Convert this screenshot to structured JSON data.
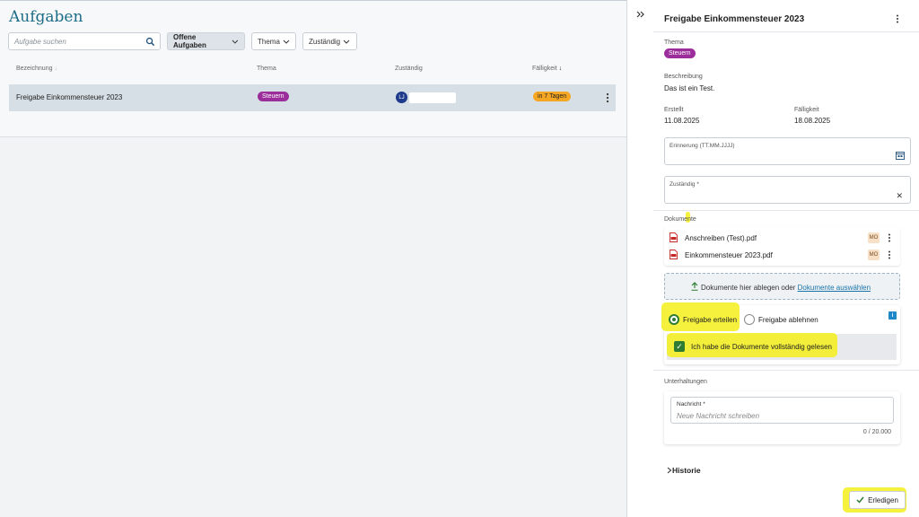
{
  "page": {
    "title": "Aufgaben"
  },
  "filters": {
    "search_placeholder": "Aufgabe suchen",
    "open_tasks": "Offene Aufgaben",
    "topic": "Thema",
    "responsible": "Zuständig"
  },
  "table": {
    "headers": {
      "name": "Bezeichnung",
      "topic": "Thema",
      "responsible": "Zuständig",
      "due": "Fälligkeit"
    },
    "rows": [
      {
        "name": "Freigabe Einkommensteuer 2023",
        "topic": "Steuern",
        "avatar": "LJ",
        "due": "in 7 Tagen"
      }
    ]
  },
  "panel": {
    "title": "Freigabe Einkommensteuer 2023",
    "topic_label": "Thema",
    "topic": "Steuern",
    "description_label": "Beschreibung",
    "description": "Das ist ein Test.",
    "created_label": "Erstellt",
    "created": "11.08.2025",
    "due_label": "Fälligkeit",
    "due": "18.08.2025",
    "reminder_label": "Erinnerung (TT.MM.JJJJ)",
    "responsible_label": "Zuständig *",
    "documents_label": "Dokumente",
    "documents": [
      {
        "name": "Anschreiben (Test).pdf",
        "owner": "MO"
      },
      {
        "name": "Einkommensteuer 2023.pdf",
        "owner": "MO"
      }
    ],
    "drop_text": "Dokumente hier ablegen oder",
    "drop_link": "Dokumente auswählen",
    "approve_label": "Freigabe erteilen",
    "reject_label": "Freigabe ablehnen",
    "confirm_read": "Ich habe die Dokumente vollständig gelesen",
    "conversations_label": "Unterhaltungen",
    "message_label": "Nachricht *",
    "message_placeholder": "Neue Nachricht schreiben",
    "counter": "0 / 20.000",
    "history": "Historie",
    "done_button": "Erledigen"
  },
  "colors": {
    "brand": "#1c6d86",
    "purple_badge": "#9b2e9b",
    "orange_badge": "#f5a623",
    "green": "#2e7d32",
    "highlight": "#f3ef1a"
  }
}
